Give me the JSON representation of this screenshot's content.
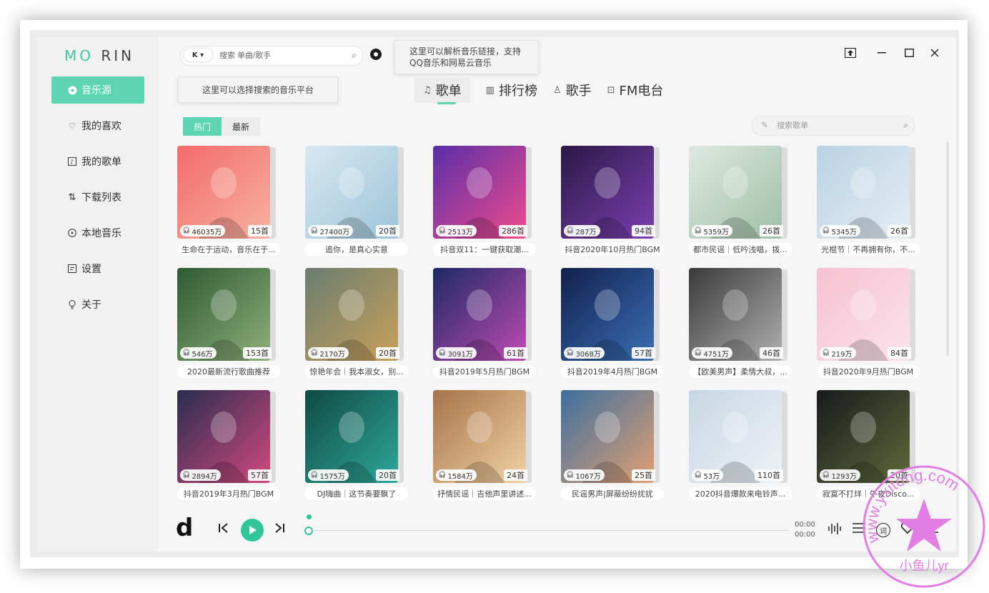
{
  "app": {
    "logo_left": "MO",
    "logo_right": "RIN"
  },
  "sidebar": {
    "items": [
      {
        "label": "音乐源",
        "icon": "disc-icon"
      },
      {
        "label": "我的喜欢",
        "icon": "heart-icon"
      },
      {
        "label": "我的歌单",
        "icon": "playlist-icon"
      },
      {
        "label": "下载列表",
        "icon": "download-sort-icon"
      },
      {
        "label": "本地音乐",
        "icon": "play-circle-icon"
      },
      {
        "label": "设置",
        "icon": "settings-icon"
      },
      {
        "label": "关于",
        "icon": "bulb-icon"
      }
    ]
  },
  "header": {
    "platform": "K ▾",
    "search_placeholder": "搜索 单曲/歌手",
    "tip_platform": "这里可以选择搜索的音乐平台",
    "tip_parse_line1": "这里可以解析音乐链接，支持",
    "tip_parse_line2": "QQ音乐和网易云音乐"
  },
  "window_controls": {
    "pin": "⇪",
    "minimize": "—",
    "maximize": "☐",
    "close": "✕"
  },
  "tabs": [
    {
      "label": "歌单",
      "icon": "♫"
    },
    {
      "label": "排行榜",
      "icon": "▥"
    },
    {
      "label": "歌手",
      "icon": "♙"
    },
    {
      "label": "FM电台",
      "icon": "⊡"
    }
  ],
  "filter": {
    "hot": "热门",
    "new": "最新",
    "search_placeholder": "搜索歌单"
  },
  "playlists": [
    {
      "plays": "46035万",
      "count": "15首",
      "title": "生命在于运动，音乐在于..."
    },
    {
      "plays": "27400万",
      "count": "20首",
      "title": "追你，是真心实意"
    },
    {
      "plays": "2513万",
      "count": "286首",
      "title": "抖音双11：一键获取潮..."
    },
    {
      "plays": "287万",
      "count": "94首",
      "title": "抖音2020年10月热门BGM"
    },
    {
      "plays": "5359万",
      "count": "26首",
      "title": "都市民谣｜低吟浅唱，拨..."
    },
    {
      "plays": "5345万",
      "count": "26首",
      "title": "光棍节｜不再拥有你，不..."
    },
    {
      "plays": "546万",
      "count": "153首",
      "title": "2020最新流行歌曲推荐"
    },
    {
      "plays": "2170万",
      "count": "20首",
      "title": "惊艳年会｜我本淑女，别..."
    },
    {
      "plays": "3091万",
      "count": "61首",
      "title": "抖音2019年5月热门BGM"
    },
    {
      "plays": "3068万",
      "count": "57首",
      "title": "抖音2019年4月热门BGM"
    },
    {
      "plays": "4751万",
      "count": "46首",
      "title": "【欧美男声】柔情大叔，..."
    },
    {
      "plays": "219万",
      "count": "84首",
      "title": "抖音2020年9月热门BGM"
    },
    {
      "plays": "2894万",
      "count": "57首",
      "title": "抖音2019年3月热门BGM"
    },
    {
      "plays": "1575万",
      "count": "20首",
      "title": "DJ嗨曲｜这节奏要飘了"
    },
    {
      "plays": "1584万",
      "count": "24首",
      "title": "抒情民谣｜吉他声里讲述..."
    },
    {
      "plays": "1067万",
      "count": "25首",
      "title": "民谣男声|屏蔽纷纷扰扰"
    },
    {
      "plays": "53万",
      "count": "110首",
      "title": "2020抖音爆款来电铃声..."
    },
    {
      "plays": "1293万",
      "count": "20首",
      "title": "寂寞不打烊｜午夜Disco..."
    }
  ],
  "colors": {
    "accent": "#5dd5b3",
    "play_button": "#2fc69a"
  },
  "player": {
    "logo": "d",
    "time_current": "00:00",
    "time_total": "00:00",
    "lyric_label": "词"
  },
  "watermark": {
    "text_arc": "www.yxitong.com",
    "text_bottom": "小鱼儿yr"
  }
}
